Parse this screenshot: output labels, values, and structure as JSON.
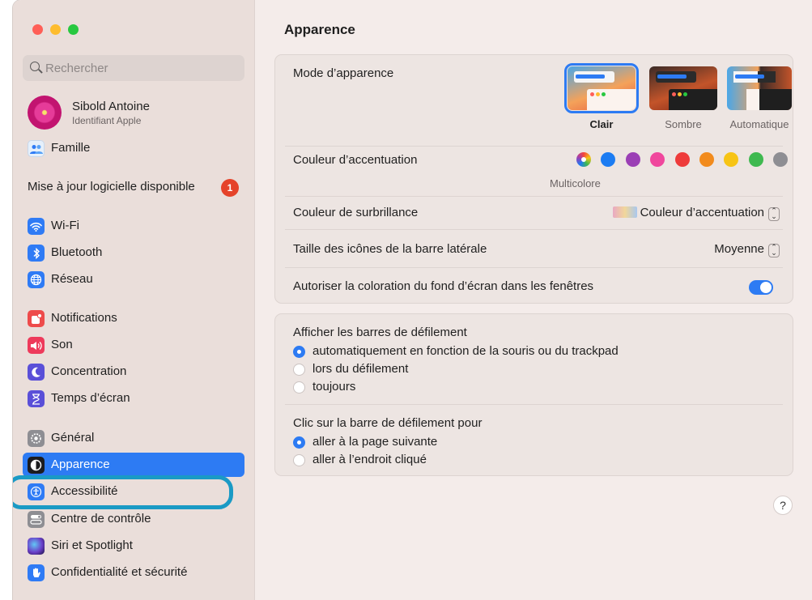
{
  "window": {
    "colors": {
      "close": "#ff5f57",
      "minimize": "#febc2e",
      "zoom": "#28c840",
      "accent": "#2d7bf3"
    }
  },
  "sidebar": {
    "search_placeholder": "Rechercher",
    "profile": {
      "name": "Sibold Antoine",
      "subtitle": "Identifiant Apple"
    },
    "family": {
      "label": "Famille",
      "icon": "family-icon"
    },
    "update": {
      "label": "Mise à jour logicielle disponible",
      "badge": "1"
    },
    "items": [
      {
        "label": "Wi-Fi",
        "icon": "wifi-icon",
        "color": "#2f7bf5"
      },
      {
        "label": "Bluetooth",
        "icon": "bluetooth-icon",
        "color": "#2f7bf5"
      },
      {
        "label": "Réseau",
        "icon": "network-icon",
        "color": "#2f7bf5"
      },
      {
        "label": "Notifications",
        "icon": "notifications-icon",
        "color": "#ee4b4b"
      },
      {
        "label": "Son",
        "icon": "sound-icon",
        "color": "#ee3a5b"
      },
      {
        "label": "Concentration",
        "icon": "focus-icon",
        "color": "#5a4fd8"
      },
      {
        "label": "Temps d’écran",
        "icon": "hourglass-icon",
        "color": "#5a4fd8"
      },
      {
        "label": "Général",
        "icon": "gear-icon",
        "color": "#8e8e93"
      },
      {
        "label": "Apparence",
        "icon": "appearance-icon",
        "color": "#1c1c1e",
        "active": true
      },
      {
        "label": "Accessibilité",
        "icon": "accessibility-icon",
        "color": "#2f7bf5"
      },
      {
        "label": "Centre de contrôle",
        "icon": "control-center-icon",
        "color": "#8e8e93"
      },
      {
        "label": "Siri et Spotlight",
        "icon": "siri-icon",
        "color": "#3a2a6b"
      },
      {
        "label": "Confidentialité et sécurité",
        "icon": "privacy-hand-icon",
        "color": "#2f7bf5"
      }
    ]
  },
  "main": {
    "title": "Apparence",
    "appearance_mode": {
      "label": "Mode d’apparence",
      "options": [
        {
          "label": "Clair",
          "selected": true
        },
        {
          "label": "Sombre",
          "selected": false
        },
        {
          "label": "Automatique",
          "selected": false
        }
      ]
    },
    "accent_color": {
      "label": "Couleur d’accentuation",
      "selected_caption": "Multicolore",
      "colors": [
        "multicolor",
        "#1c7cf2",
        "#9b3fb5",
        "#f0479d",
        "#ee3b3b",
        "#f28b1d",
        "#f7c415",
        "#3fb950",
        "#8e8e93"
      ]
    },
    "highlight_color": {
      "label": "Couleur de surbrillance",
      "value": "Couleur d’accentuation"
    },
    "sidebar_icon_size": {
      "label": "Taille des icônes de la barre latérale",
      "value": "Moyenne"
    },
    "wallpaper_tinting": {
      "label": "Autoriser la coloration du fond d’écran dans les fenêtres",
      "on": true
    },
    "scrollbars": {
      "label": "Afficher les barres de défilement",
      "options": [
        {
          "label": "automatiquement en fonction de la souris ou du trackpad",
          "selected": true
        },
        {
          "label": "lors du défilement",
          "selected": false
        },
        {
          "label": "toujours",
          "selected": false
        }
      ]
    },
    "scroll_click": {
      "label": "Clic sur la barre de défilement pour",
      "options": [
        {
          "label": "aller à la page suivante",
          "selected": true
        },
        {
          "label": "aller à l’endroit cliqué",
          "selected": false
        }
      ]
    },
    "help": "?"
  }
}
